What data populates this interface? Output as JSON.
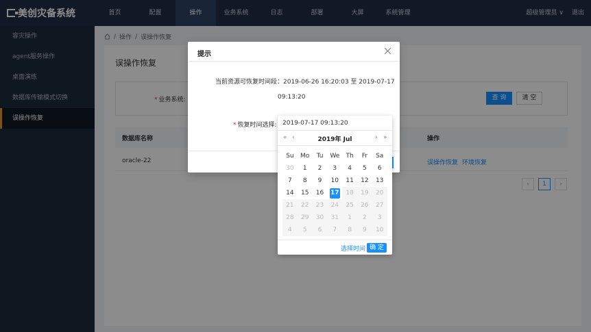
{
  "app": {
    "title": "美创灾备系统"
  },
  "nav": {
    "items": [
      "首页",
      "配置",
      "操作",
      "业务系统",
      "日志",
      "部署",
      "大屏",
      "系统管理"
    ],
    "active": 2
  },
  "header": {
    "user": "超级管理员 ∨",
    "logout": "退出"
  },
  "sidebar": {
    "items": [
      "容灾操作",
      "agent服务操作",
      "桌面演练",
      "数据库传输模式切换",
      "误操作恢复"
    ],
    "active": 4
  },
  "breadcrumb": {
    "items": [
      "操作",
      "误操作恢复"
    ],
    "sep": "/"
  },
  "page": {
    "title": "误操作恢复",
    "filter_label": "业务系统:",
    "query_label": "查 询",
    "clear_label": "清 空",
    "columns": [
      "数据库名称",
      "操作"
    ],
    "rows": [
      {
        "name": "oracle-22",
        "actions": [
          "误操作恢复",
          "环境恢复"
        ]
      }
    ],
    "pager": {
      "prev": "‹",
      "current": "1",
      "next": "›"
    }
  },
  "dialog": {
    "title": "提示",
    "range_text": "当前资源可恢复时间段：2019-06-26 16:20:03 至 2019-07-17",
    "range_text_cont": "09:13:20",
    "time_label": "恢复时间选择:"
  },
  "picker": {
    "value": "2019-07-17 09:13:20",
    "title": "2019年 Jul",
    "prev_year": "«",
    "prev_month": "‹",
    "next_month": "›",
    "next_year": "»",
    "weekdays": [
      "Su",
      "Mo",
      "Tu",
      "We",
      "Th",
      "Fr",
      "Sa"
    ],
    "weeks": [
      [
        "30",
        "1",
        "2",
        "3",
        "4",
        "5",
        "6"
      ],
      [
        "7",
        "8",
        "9",
        "10",
        "11",
        "12",
        "13"
      ],
      [
        "14",
        "15",
        "16",
        "17",
        "18",
        "19",
        "20"
      ],
      [
        "21",
        "22",
        "23",
        "24",
        "25",
        "26",
        "27"
      ],
      [
        "28",
        "29",
        "30",
        "31",
        "1",
        "2",
        "3"
      ],
      [
        "4",
        "5",
        "6",
        "7",
        "8",
        "9",
        "10"
      ]
    ],
    "selected": "17",
    "select_time": "选择时间",
    "ok": "确 定"
  },
  "colors": {
    "primary": "#1890ff",
    "nav_bg": "#1f2d45",
    "sidebar_bg": "#1d2a3d",
    "accent": "#e09a2e"
  }
}
